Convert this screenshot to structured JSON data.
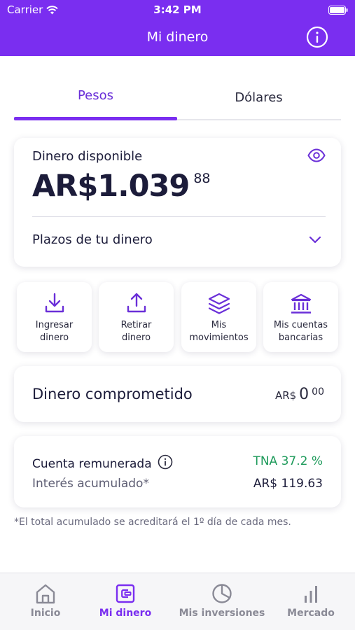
{
  "status_bar": {
    "carrier": "Carrier",
    "time": "3:42 PM"
  },
  "header": {
    "title": "Mi dinero",
    "info_icon": "info-icon"
  },
  "tabs": [
    {
      "label": "Pesos",
      "active": true
    },
    {
      "label": "Dólares",
      "active": false
    }
  ],
  "balance": {
    "label": "Dinero disponible",
    "amount": "AR$1.039",
    "cents": "88",
    "plazos_label": "Plazos de tu dinero"
  },
  "actions": [
    {
      "line1": "Ingresar",
      "line2": "dinero",
      "icon": "download-icon"
    },
    {
      "line1": "Retirar",
      "line2": "dinero",
      "icon": "upload-icon"
    },
    {
      "line1": "Mis",
      "line2": "movimientos",
      "icon": "layers-icon"
    },
    {
      "line1": "Mis cuentas",
      "line2": "bancarias",
      "icon": "bank-icon"
    }
  ],
  "comprometido": {
    "label": "Dinero comprometido",
    "currency": "AR$",
    "integer": "0",
    "cents": "00"
  },
  "remunerada": {
    "label": "Cuenta remunerada",
    "tna": "TNA 37.2 %",
    "interest_label": "Interés acumulado*",
    "interest_value": "AR$ 119.63"
  },
  "footnote": "*El total acumulado se acreditará el 1º día de cada mes.",
  "bottom_nav": [
    {
      "label": "Inicio",
      "icon": "home-icon",
      "active": false
    },
    {
      "label": "Mi dinero",
      "icon": "wallet-icon",
      "active": true
    },
    {
      "label": "Mis inversiones",
      "icon": "pie-chart-icon",
      "active": false
    },
    {
      "label": "Mercado",
      "icon": "bar-chart-icon",
      "active": false
    }
  ],
  "colors": {
    "brand": "#7a2ef0",
    "positive": "#1d9a5a"
  }
}
